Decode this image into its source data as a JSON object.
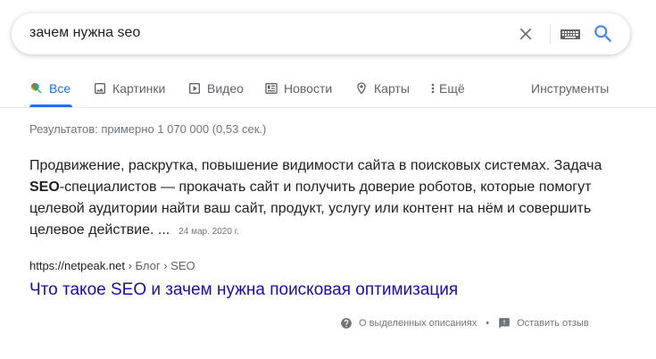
{
  "search": {
    "query": "зачем нужна seo"
  },
  "tabs": [
    {
      "label": "Все",
      "icon": "search-icon",
      "active": true
    },
    {
      "label": "Картинки",
      "icon": "image-icon"
    },
    {
      "label": "Видео",
      "icon": "video-icon"
    },
    {
      "label": "Новости",
      "icon": "news-icon"
    },
    {
      "label": "Карты",
      "icon": "map-pin-icon"
    },
    {
      "label": "Ещё",
      "icon": "more-vert-icon"
    }
  ],
  "tools_label": "Инструменты",
  "stats": "Результатов: примерно 1 070 000 (0,53 сек.)",
  "snippet": {
    "lead": "Продвижение, раскрутка, повышение видимости сайта в поисковых системах. Задача ",
    "bold": "SEO",
    "rest": "-специалистов — прокачать сайт и получить доверие роботов, которые помогут целевой аудитории найти ваш сайт, продукт, услугу или контент на нём и совершить целевое действие. ...",
    "date": "24 мар. 2020 г."
  },
  "result": {
    "domain": "https://netpeak.net",
    "breadcrumb": " › Блог › SEO",
    "title": "Что такое SEO и зачем нужна поисковая оптимизация"
  },
  "footer": {
    "about": "О выделенных описаниях",
    "separator": "•",
    "feedback": "Оставить отзыв"
  },
  "colors": {
    "accent": "#1a73e8",
    "link": "#1a0dab",
    "muted": "#70757a"
  }
}
